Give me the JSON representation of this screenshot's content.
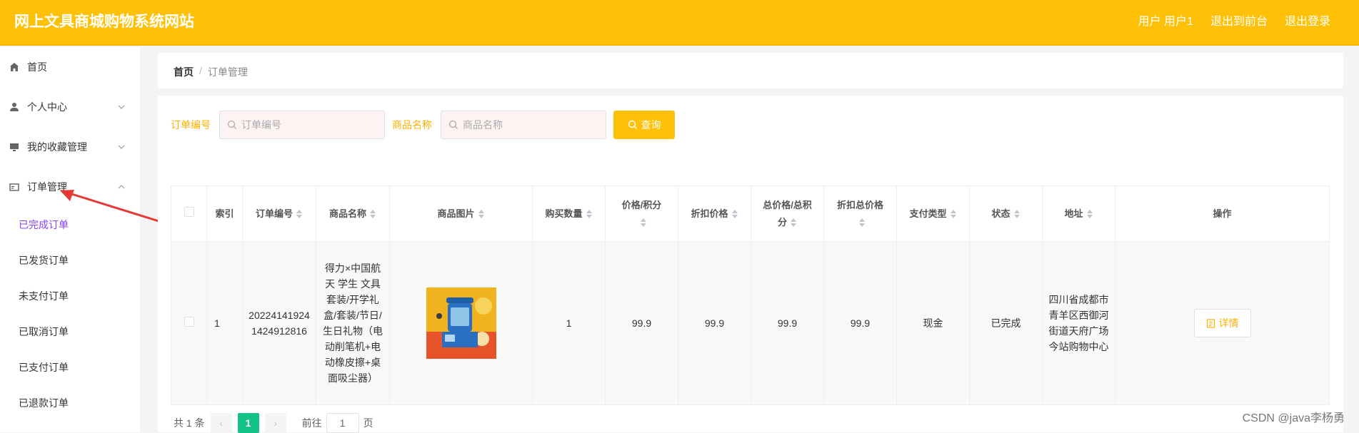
{
  "header": {
    "brand": "网上文具商城购物系统网站",
    "user_label": "用户 用户1",
    "to_front_label": "退出到前台",
    "logout_label": "退出登录"
  },
  "sidebar": {
    "items": [
      {
        "label": "首页",
        "icon": "home-icon"
      },
      {
        "label": "个人中心",
        "icon": "user-icon"
      },
      {
        "label": "我的收藏管理",
        "icon": "monitor-icon"
      },
      {
        "label": "订单管理",
        "icon": "card-icon"
      }
    ],
    "sub_items": [
      "已完成订单",
      "已发货订单",
      "未支付订单",
      "已取消订单",
      "已支付订单",
      "已退款订单"
    ]
  },
  "breadcrumb": {
    "home": "首页",
    "sep": "/",
    "current": "订单管理"
  },
  "search": {
    "order_no_label": "订单编号",
    "order_no_placeholder": "订单编号",
    "product_name_label": "商品名称",
    "product_name_placeholder": "商品名称",
    "query_label": "查询"
  },
  "table": {
    "headers": [
      "索引",
      "订单编号",
      "商品名称",
      "商品图片",
      "购买数量",
      "价格/积分",
      "折扣价格",
      "总价格/总积分",
      "折扣总价格",
      "支付类型",
      "状态",
      "地址",
      "操作"
    ],
    "rows": [
      {
        "index": "1",
        "order_no": "202241419241424912816",
        "product_name": "得力×中国航天 学生 文具套装/开学礼盒/套装/节日/生日礼物（电动削笔机+电动橡皮擦+桌面吸尘器）",
        "quantity": "1",
        "price": "99.9",
        "discount_price": "99.9",
        "total_price": "99.9",
        "discount_total": "99.9",
        "pay_type": "现金",
        "status": "已完成",
        "address": "四川省成都市青羊区西御河街道天府广场今站购物中心",
        "action": "详情"
      }
    ]
  },
  "pager": {
    "total": "共 1 条",
    "page": "1",
    "goto_label": "前往",
    "goto_value": "1",
    "page_suffix": "页"
  },
  "watermark": "CSDN @java李杨勇",
  "colors": {
    "header": "#ffc107",
    "active_sub": "#8a3ffc",
    "page_active": "#13c285",
    "annotation_arrow": "#e53935"
  }
}
